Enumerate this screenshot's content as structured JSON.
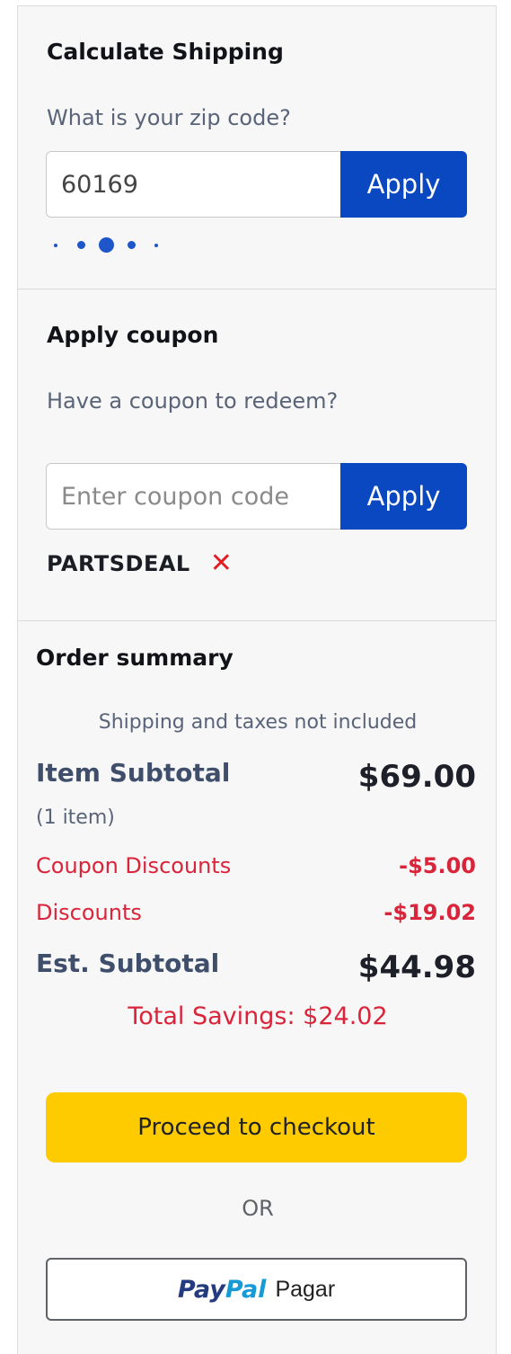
{
  "shipping": {
    "title": "Calculate Shipping",
    "prompt": "What is your zip code?",
    "zip_value": "60169",
    "apply_label": "Apply"
  },
  "coupon": {
    "title": "Apply coupon",
    "prompt": "Have a coupon to redeem?",
    "placeholder": "Enter coupon code",
    "apply_label": "Apply",
    "applied_code": "PARTSDEAL",
    "remove_symbol": "✕"
  },
  "summary": {
    "title": "Order summary",
    "note": "Shipping and taxes not included",
    "item_subtotal_label": "Item Subtotal",
    "item_count": "(1 item)",
    "item_subtotal_value": "$69.00",
    "coupon_discounts_label": "Coupon Discounts",
    "coupon_discounts_value": "-$5.00",
    "discounts_label": "Discounts",
    "discounts_value": "-$19.02",
    "est_subtotal_label": "Est. Subtotal",
    "est_subtotal_value": "$44.98",
    "total_savings": "Total Savings: $24.02"
  },
  "checkout": {
    "proceed_label": "Proceed to checkout",
    "or_label": "OR",
    "paypal_pay": "Pay",
    "paypal_pal": "Pal",
    "paypal_text": "Pagar"
  },
  "colors": {
    "apply_button": "#0a48c2",
    "checkout_button": "#fdcb00",
    "discount_red": "#d9243a",
    "remove_red": "#e11d26"
  },
  "icons": {
    "loading": "loading-dots-icon",
    "remove": "close-icon"
  }
}
